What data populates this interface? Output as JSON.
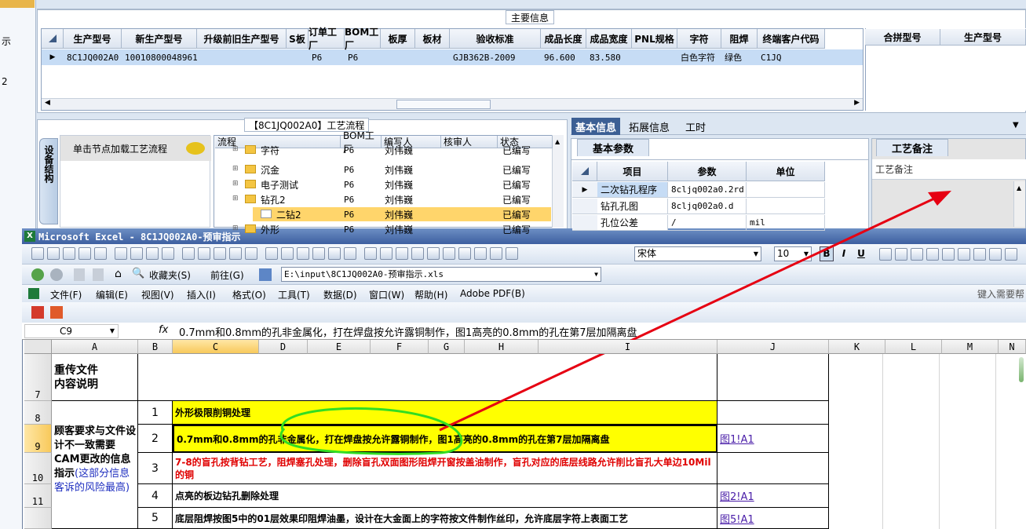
{
  "left_panel": {
    "items": [
      "示",
      "2"
    ]
  },
  "main_info": {
    "title": "主要信息",
    "columns": [
      "生产型号",
      "新生产型号",
      "升级前旧生产型号",
      "S板",
      "订单工厂",
      "BOM工厂",
      "板厚",
      "板材",
      "验收标准",
      "成品长度",
      "成品宽度",
      "PNL规格",
      "字符",
      "阻焊",
      "终端客户代码"
    ],
    "row": [
      "8C1JQ002A0",
      "10010800048961",
      "",
      "",
      "P6",
      "P6",
      "",
      "",
      "GJB362B-2009",
      "96.600",
      "83.580",
      "",
      "白色字符",
      "绿色",
      "C1JQ"
    ],
    "side_columns": [
      "合拼型号",
      "生产型号"
    ]
  },
  "process": {
    "title": "【8C1JQ002A0】工艺流程",
    "side_tab": "设备结构",
    "load_hint": "单击节点加载工艺流程",
    "columns": [
      "流程",
      "BOM工厂",
      "编写人",
      "核审人",
      "状态"
    ],
    "rows": [
      {
        "name": "字符",
        "factory": "P6",
        "writer": "刘伟巍",
        "reviewer": "",
        "status": "已编写"
      },
      {
        "name": "沉金",
        "factory": "P6",
        "writer": "刘伟巍",
        "reviewer": "",
        "status": "已编写"
      },
      {
        "name": "电子测试",
        "factory": "P6",
        "writer": "刘伟巍",
        "reviewer": "",
        "status": "已编写"
      },
      {
        "name": "钻孔2",
        "factory": "P6",
        "writer": "刘伟巍",
        "reviewer": "",
        "status": "已编写"
      },
      {
        "name": "二钻2",
        "factory": "P6",
        "writer": "刘伟巍",
        "reviewer": "",
        "status": "已编写"
      },
      {
        "name": "外形",
        "factory": "P6",
        "writer": "刘伟巍",
        "reviewer": "",
        "status": "已编写"
      }
    ]
  },
  "info_tabs": {
    "tabs": [
      "基本信息",
      "拓展信息",
      "工时"
    ],
    "sub_tab": "基本参数",
    "columns": [
      "项目",
      "参数",
      "单位"
    ],
    "rows": [
      {
        "item": "二次钻孔程序",
        "param": "8cljq002a0.2rd",
        "unit": ""
      },
      {
        "item": "钻孔孔图",
        "param": "8cljq002a0.d",
        "unit": ""
      },
      {
        "item": "孔位公差",
        "param": "/",
        "unit": "mil"
      }
    ]
  },
  "craft_note": {
    "tab": "工艺备注",
    "label": "工艺备注"
  },
  "excel": {
    "title": "Microsoft Excel - 8C1JQ002A0-预审指示",
    "font_name": "宋体",
    "font_size": "10",
    "favorites": "收藏夹(S)",
    "goto": "前往(G)",
    "path": "E:\\input\\8C1JQ002A0-预审指示.xls",
    "menus": [
      "文件(F)",
      "编辑(E)",
      "视图(V)",
      "插入(I)",
      "格式(O)",
      "工具(T)",
      "数据(D)",
      "窗口(W)",
      "帮助(H)",
      "Adobe PDF(B)"
    ],
    "help_hint": "键入需要帮助",
    "name_box": "C9",
    "fx": "fx",
    "formula": "0.7mm和0.8mm的孔非金属化，打在焊盘按允许露铜制作，图1高亮的0.8mm的孔在第7层加隔离盘",
    "columns": [
      "A",
      "B",
      "C",
      "D",
      "E",
      "F",
      "G",
      "H",
      "I",
      "J",
      "K",
      "L",
      "M",
      "N"
    ],
    "row_numbers": [
      "7",
      "8",
      "9",
      "10",
      "11"
    ],
    "a7": "重传文件\n内容说明",
    "a_merged": "顾客要求与文件设计不一致需要CAM更改的信息指示",
    "a_merged_note": "(这部分信息客诉的风险最高)",
    "items": [
      {
        "no": "1",
        "text": "外形极限削铜处理",
        "link": ""
      },
      {
        "no": "2",
        "text": "0.7mm和0.8mm的孔非金属化，打在焊盘按允许露铜制作，图1高亮的0.8mm的孔在第7层加隔离盘",
        "link": "图1!A1"
      },
      {
        "no": "3",
        "text": "7-8的盲孔按背钻工艺，阻焊塞孔处理，删除盲孔双面图形阻焊开窗按盖油制作，盲孔对应的底层线路允许削比盲孔大单边10Mil的铜",
        "link": ""
      },
      {
        "no": "4",
        "text": "点亮的板边钻孔删除处理",
        "link": "图2!A1"
      },
      {
        "no": "5",
        "text": "底层阻焊按图5中的01层效果印阻焊油墨，设计在大金面上的字符按文件制作丝印，允许底层字符上表面工艺",
        "link": "图5!A1"
      }
    ]
  },
  "colors": {
    "highlight_yellow": "#ffff00",
    "red_text": "#ff0000",
    "annotation_red": "#e60012",
    "annotation_green": "#33dd22"
  }
}
